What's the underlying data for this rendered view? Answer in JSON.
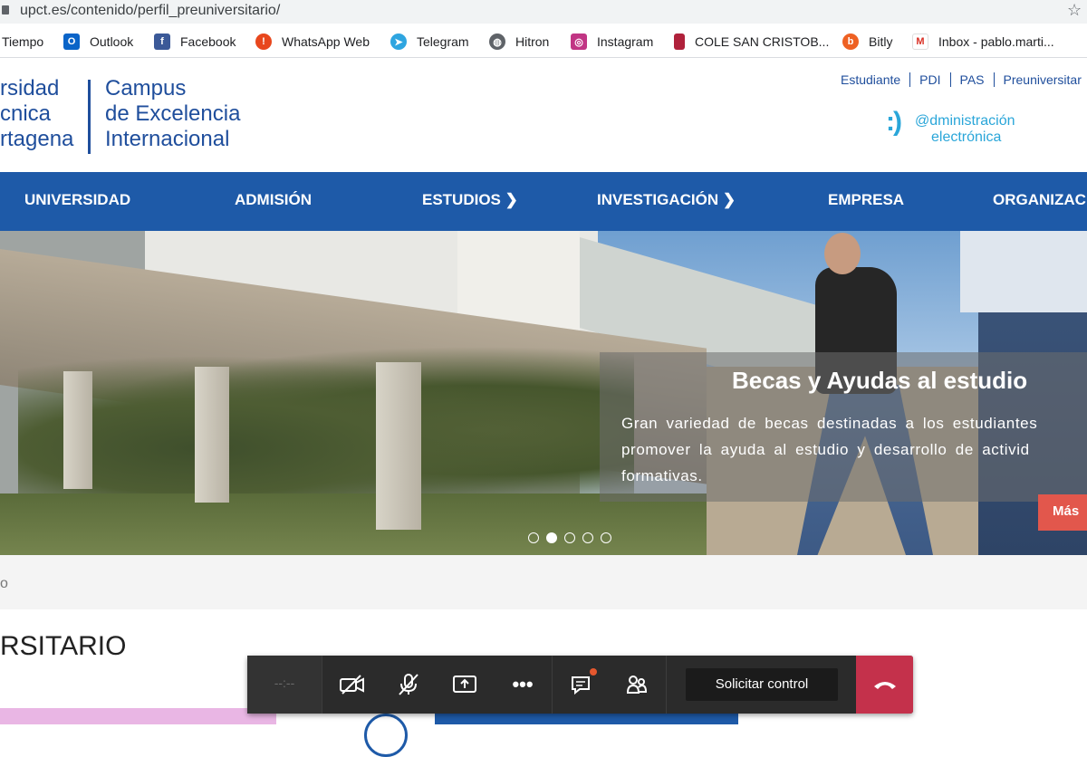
{
  "browser": {
    "url": "upct.es/contenido/perfil_preuniversitario/",
    "bookmarks": [
      {
        "label": "Tiempo",
        "icon": "cloud-icon"
      },
      {
        "label": "Outlook",
        "icon": "outlook-icon"
      },
      {
        "label": "Facebook",
        "icon": "facebook-icon"
      },
      {
        "label": "WhatsApp Web",
        "icon": "whatsapp-icon"
      },
      {
        "label": "Telegram",
        "icon": "telegram-icon"
      },
      {
        "label": "Hitron",
        "icon": "globe-icon"
      },
      {
        "label": "Instagram",
        "icon": "instagram-icon"
      },
      {
        "label": "COLE SAN CRISTOB...",
        "icon": "school-icon"
      },
      {
        "label": "Bitly",
        "icon": "bitly-icon"
      },
      {
        "label": "Inbox - pablo.marti...",
        "icon": "gmail-icon"
      }
    ]
  },
  "header": {
    "logo_left": [
      "rsidad",
      "cnica",
      "rtagena"
    ],
    "logo_right": [
      "Campus",
      "de Excelencia",
      "Internacional"
    ],
    "top_links": [
      "Estudiante",
      "PDI",
      "PAS",
      "Preuniversitar"
    ],
    "eadmin_mark": ":)",
    "eadmin_line1": "@dministración",
    "eadmin_line2": "electrónica"
  },
  "nav": {
    "items": [
      {
        "label": "UNIVERSIDAD"
      },
      {
        "label": "ADMISIÓN"
      },
      {
        "label": "ESTUDIOS ❯"
      },
      {
        "label": "INVESTIGACIÓN ❯"
      },
      {
        "label": "EMPRESA"
      },
      {
        "label": "ORGANIZAC"
      }
    ]
  },
  "hero": {
    "title": "Becas y Ayudas al estudio",
    "body": "Gran variedad de becas destinadas a los estudiantes promover la ayuda al estudio y desarrollo de activid formativas.",
    "more_label": "Más",
    "slide_count": 5,
    "active_slide": 2
  },
  "breadcrumb": {
    "text": "o"
  },
  "page_title": "RSITARIO",
  "meeting_toolbar": {
    "timer": "--:--",
    "request_control_label": "Solicitar control",
    "colors": {
      "bar": "#2b2b2b",
      "hangup": "#c4314b",
      "notification": "#e4572e"
    }
  },
  "colors": {
    "brand_blue": "#1e5aa8",
    "accent_red": "#e2574c"
  }
}
